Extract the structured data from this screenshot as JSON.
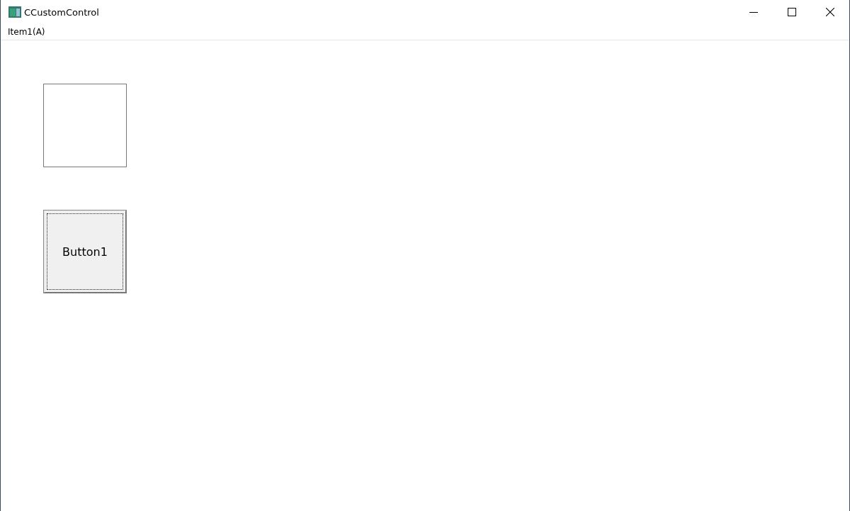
{
  "window": {
    "title": "CCustomControl"
  },
  "menu": [
    {
      "label": "Item1(A)"
    }
  ],
  "controls": [
    {
      "kind": "panel"
    },
    {
      "kind": "button",
      "label": "Button1",
      "focused": true
    }
  ]
}
